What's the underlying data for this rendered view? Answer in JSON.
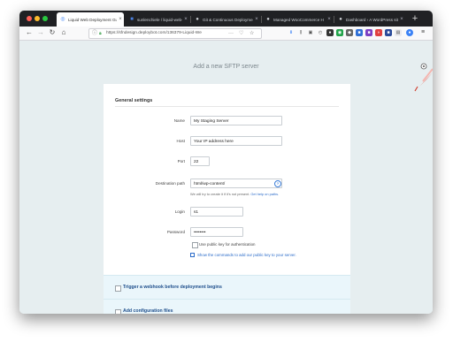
{
  "browser": {
    "tabs": [
      {
        "title": "Liquid Web Deployment Gu",
        "active": true,
        "icon": "globe-icon"
      },
      {
        "title": "sunlenchiele / liquid-web-",
        "active": false,
        "icon": "bookmark-icon"
      },
      {
        "title": "Git & Continuous Deployme",
        "active": false,
        "icon": "droplet-icon"
      },
      {
        "title": "Managed WooCommerce H",
        "active": false,
        "icon": "droplet-icon"
      },
      {
        "title": "Dashboard ‹ A WordPress site",
        "active": false,
        "icon": "droplet-icon"
      }
    ],
    "new_tab_label": "+",
    "url": "https://sfndesign.deploybot.com/136379-Liquid-We",
    "url_more": "···",
    "close_glyph": "×"
  },
  "page": {
    "title": "Add a new SFTP server",
    "section_title": "General settings",
    "fields": {
      "name_label": "Name",
      "name_value": "My Staging Server",
      "host_label": "Host",
      "host_value": "Your IP address here",
      "port_label": "Port",
      "port_value": "22",
      "dest_label": "Destination path",
      "dest_value": "html/wp-content/",
      "dest_hint": "We will try to create it if it's not present.",
      "dest_hint_link": "Get help on paths.",
      "login_label": "Login",
      "login_value": "s1",
      "password_label": "Password",
      "password_value": "••••••••"
    },
    "public_key_checkbox": "Use public key for authentication",
    "show_commands_link": "Show the commands to add our public key to your server.",
    "webhook_section": "Trigger a webhook before deployment begins",
    "config_section": "Add configuration files"
  }
}
